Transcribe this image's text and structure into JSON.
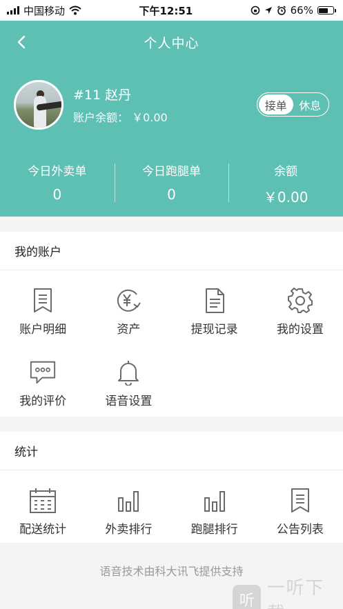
{
  "status_bar": {
    "carrier": "中国移动",
    "time": "下午12:51",
    "battery": "66%",
    "battery_level": 0.66
  },
  "header": {
    "title": "个人中心",
    "back_icon": "chevron-left-icon",
    "user": {
      "name": "#11 赵丹",
      "balance_label": "账户余额：",
      "balance_value": "￥0.00"
    },
    "toggle": {
      "on_label": "接单",
      "off_label": "休息",
      "selected": "接单"
    },
    "stats": [
      {
        "label": "今日外卖单",
        "value": "0"
      },
      {
        "label": "今日跑腿单",
        "value": "0"
      },
      {
        "label": "余额",
        "value": "￥0.00"
      }
    ],
    "accent_color": "#5ec0b3"
  },
  "my_account": {
    "title": "我的账户",
    "items": [
      {
        "label": "账户明细",
        "icon": "bookmark-list-icon"
      },
      {
        "label": "资产",
        "icon": "yuan-refresh-icon"
      },
      {
        "label": "提现记录",
        "icon": "document-icon"
      },
      {
        "label": "我的设置",
        "icon": "gear-icon"
      },
      {
        "label": "我的评价",
        "icon": "chat-bubble-icon"
      },
      {
        "label": "语音设置",
        "icon": "bell-icon"
      }
    ]
  },
  "statistics": {
    "title": "统计",
    "items": [
      {
        "label": "配送统计",
        "icon": "calendar-icon"
      },
      {
        "label": "外卖排行",
        "icon": "bar-chart-icon"
      },
      {
        "label": "跑腿排行",
        "icon": "bar-chart-icon"
      },
      {
        "label": "公告列表",
        "icon": "bookmark-list-icon"
      }
    ]
  },
  "footer": {
    "text": "语音技术由科大讯飞提供支持"
  },
  "watermark": {
    "badge": "听",
    "text": "一听下载"
  }
}
